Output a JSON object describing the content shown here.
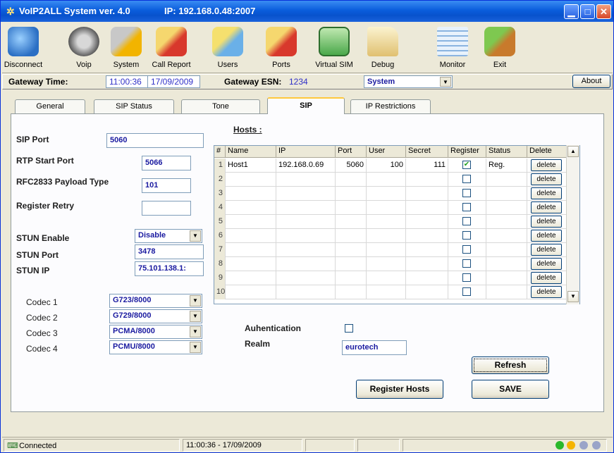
{
  "window": {
    "title": "VoIP2ALL System ver. 4.0",
    "ip_info": "IP: 192.168.0.48:2007"
  },
  "toolbar": [
    {
      "label": "Disconnect",
      "icon": "disconnect-icon"
    },
    {
      "label": "Voip",
      "icon": "voip-icon"
    },
    {
      "label": "System",
      "icon": "system-icon"
    },
    {
      "label": "Call Report",
      "icon": "call-report-icon"
    },
    {
      "label": "Users",
      "icon": "users-icon"
    },
    {
      "label": "Ports",
      "icon": "ports-icon"
    },
    {
      "label": "Virtual SIM",
      "icon": "virtual-sim-icon"
    },
    {
      "label": "Debug",
      "icon": "debug-icon"
    },
    {
      "label": "Monitor",
      "icon": "monitor-icon"
    },
    {
      "label": "Exit",
      "icon": "exit-icon"
    }
  ],
  "gateway": {
    "time_label": "Gateway Time:",
    "time_value": "11:00:36",
    "date_value": "17/09/2009",
    "esn_label": "Gateway ESN:",
    "esn_value": "1234",
    "mode_value": "System",
    "about_label": "About"
  },
  "tabs": [
    {
      "label": "General",
      "active": false
    },
    {
      "label": "SIP Status",
      "active": false
    },
    {
      "label": "Tone",
      "active": false
    },
    {
      "label": "SIP",
      "active": true
    },
    {
      "label": "IP Restrictions",
      "active": false
    }
  ],
  "sip": {
    "sip_port_label": "SIP Port",
    "sip_port_value": "5060",
    "rtp_port_label": "RTP Start Port",
    "rtp_port_value": "5066",
    "rfc2833_label": "RFC2833 Payload Type",
    "rfc2833_value": "101",
    "register_retry_label": "Register Retry",
    "register_retry_value": "",
    "stun_enable_label": "STUN Enable",
    "stun_enable_value": "Disable",
    "stun_port_label": "STUN Port",
    "stun_port_value": "3478",
    "stun_ip_label": "STUN IP",
    "stun_ip_value": "75.101.138.1:",
    "codecs": [
      {
        "label": "Codec 1",
        "value": "G723/8000"
      },
      {
        "label": "Codec 2",
        "value": "G729/8000"
      },
      {
        "label": "Codec 3",
        "value": "PCMA/8000"
      },
      {
        "label": "Codec 4",
        "value": "PCMU/8000"
      }
    ]
  },
  "hosts": {
    "title": "Hosts :",
    "columns": [
      "#",
      "Name",
      "IP",
      "Port",
      "User",
      "Secret",
      "Register",
      "Status",
      "Delete"
    ],
    "rows": [
      {
        "num": "1",
        "name": "Host1",
        "ip": "192.168.0.69",
        "port": "5060",
        "user": "100",
        "secret": "111",
        "register": true,
        "status": "Reg.",
        "delete": "delete"
      },
      {
        "num": "2",
        "name": "",
        "ip": "",
        "port": "",
        "user": "",
        "secret": "",
        "register": false,
        "status": "",
        "delete": "delete"
      },
      {
        "num": "3",
        "name": "",
        "ip": "",
        "port": "",
        "user": "",
        "secret": "",
        "register": false,
        "status": "",
        "delete": "delete"
      },
      {
        "num": "4",
        "name": "",
        "ip": "",
        "port": "",
        "user": "",
        "secret": "",
        "register": false,
        "status": "",
        "delete": "delete"
      },
      {
        "num": "5",
        "name": "",
        "ip": "",
        "port": "",
        "user": "",
        "secret": "",
        "register": false,
        "status": "",
        "delete": "delete"
      },
      {
        "num": "6",
        "name": "",
        "ip": "",
        "port": "",
        "user": "",
        "secret": "",
        "register": false,
        "status": "",
        "delete": "delete"
      },
      {
        "num": "7",
        "name": "",
        "ip": "",
        "port": "",
        "user": "",
        "secret": "",
        "register": false,
        "status": "",
        "delete": "delete"
      },
      {
        "num": "8",
        "name": "",
        "ip": "",
        "port": "",
        "user": "",
        "secret": "",
        "register": false,
        "status": "",
        "delete": "delete"
      },
      {
        "num": "9",
        "name": "",
        "ip": "",
        "port": "",
        "user": "",
        "secret": "",
        "register": false,
        "status": "",
        "delete": "delete"
      },
      {
        "num": "10",
        "name": "",
        "ip": "",
        "port": "",
        "user": "",
        "secret": "",
        "register": false,
        "status": "",
        "delete": "delete"
      }
    ]
  },
  "auth": {
    "auth_label": "Auhentication",
    "realm_label": "Realm",
    "realm_value": "eurotech"
  },
  "buttons": {
    "refresh": "Refresh",
    "register_hosts": "Register Hosts",
    "save": "SAVE"
  },
  "status": {
    "connection": "Connected",
    "timestamp": "11:00:36 - 17/09/2009"
  },
  "colors": {
    "titlebar": "#0a5ddc",
    "field_text": "#1a1aa0",
    "check_green": "#21a121"
  }
}
